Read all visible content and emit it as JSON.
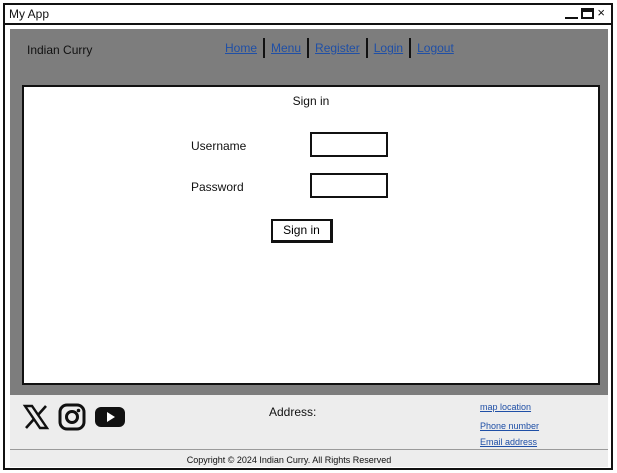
{
  "window": {
    "title": "My App",
    "controls": {
      "minimize": "minimize-icon",
      "maximize": "maximize-icon",
      "close": "close-icon",
      "close_glyph": "×"
    }
  },
  "header": {
    "brand": "Indian Curry",
    "nav": [
      {
        "label": "Home"
      },
      {
        "label": "Menu"
      },
      {
        "label": "Register"
      },
      {
        "label": "Login"
      },
      {
        "label": "Logout"
      }
    ]
  },
  "signin": {
    "title": "Sign in",
    "username_label": "Username",
    "username_value": "",
    "password_label": "Password",
    "password_value": "",
    "button_label": "Sign in"
  },
  "footer": {
    "social": [
      {
        "icon": "x-twitter-icon"
      },
      {
        "icon": "instagram-icon"
      },
      {
        "icon": "youtube-icon"
      }
    ],
    "address_label": "Address:",
    "links": {
      "map": "map location",
      "phone": "Phone number",
      "email": "Email address"
    },
    "copyright": "Copyright © 2024 Indian Curry. All Rights Reserved"
  },
  "colors": {
    "background": "#7d7d7d",
    "footer_background": "#ededed",
    "link": "#1f4fa6",
    "border": "#111111"
  }
}
